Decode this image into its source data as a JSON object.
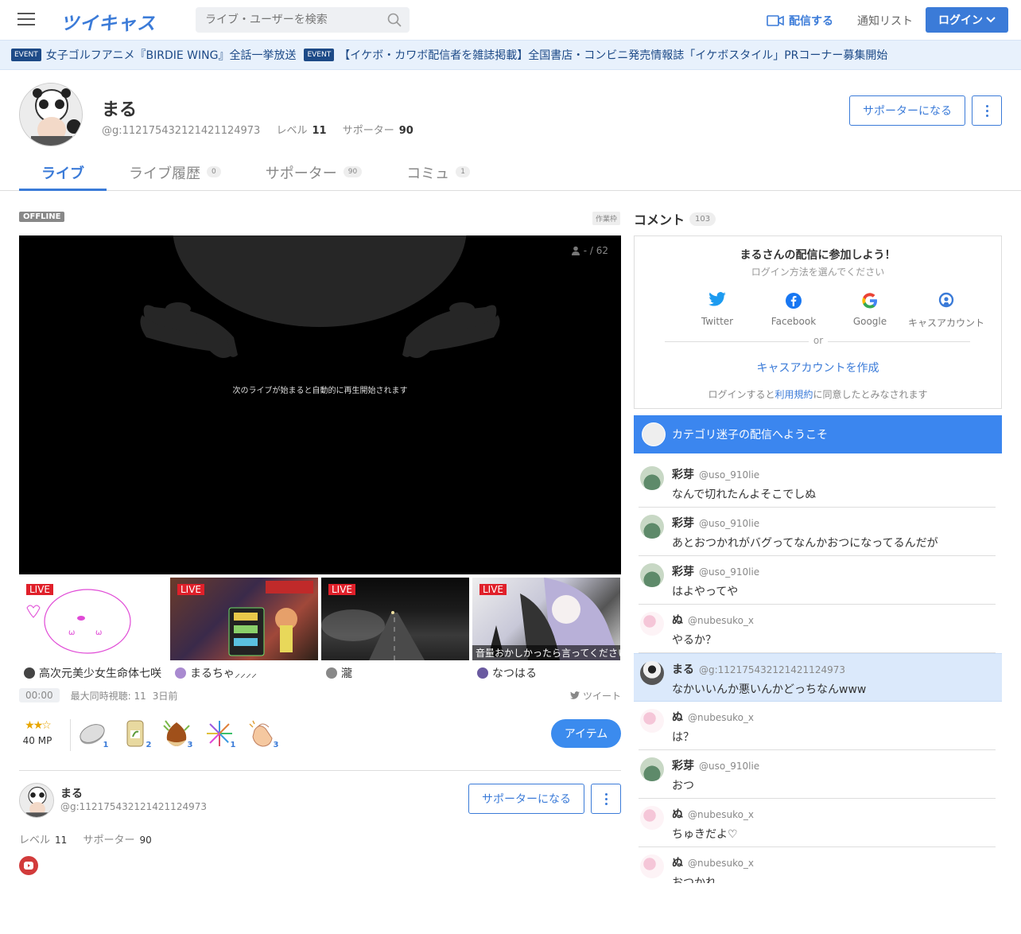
{
  "header": {
    "logo": "ツイキャス",
    "search_placeholder": "ライブ・ユーザーを検索",
    "stream_label": "配信する",
    "notif_label": "通知リスト",
    "login_label": "ログイン"
  },
  "events": [
    {
      "tag": "EVENT",
      "text": "女子ゴルフアニメ『BIRDIE WING』全話一挙放送"
    },
    {
      "tag": "EVENT",
      "text": "【イケボ・カワボ配信者を雑誌掲載】全国書店・コンビニ発売情報誌「イケボスタイル」PRコーナー募集開始"
    }
  ],
  "profile": {
    "name": "まる",
    "id": "@g:112175432121421124973",
    "level_label": "レベル",
    "level": "11",
    "supporter_label": "サポーター",
    "supporters": "90",
    "support_btn": "サポーターになる"
  },
  "tabs": [
    {
      "label": "ライブ",
      "count": ""
    },
    {
      "label": "ライブ履歴",
      "count": "0"
    },
    {
      "label": "サポーター",
      "count": "90"
    },
    {
      "label": "コミュ",
      "count": "1"
    }
  ],
  "player": {
    "status": "OFFLINE",
    "work_tag": "作業枠",
    "viewers": "- / 62",
    "message": "次のライブが始まると自動的に再生開始されます"
  },
  "thumbs": [
    {
      "live": "LIVE",
      "caption": "",
      "name": "高次元美少女生命体七咲"
    },
    {
      "live": "LIVE",
      "caption": "",
      "name": "まるちゃ⸝⸝⸝⸝"
    },
    {
      "live": "LIVE",
      "caption": "",
      "name": "  瀧  "
    },
    {
      "live": "LIVE",
      "caption": "音量おかしかったら言ってください",
      "name": "なつはる"
    }
  ],
  "timebar": {
    "time": "00:00",
    "max_viewers": "最大同時視聴: 11",
    "ago": "3日前",
    "tweet": "ツイート"
  },
  "items": {
    "mp": "40 MP",
    "gifts": [
      {
        "icon": "coin-icon",
        "count": "1"
      },
      {
        "icon": "tea-icon",
        "count": "2"
      },
      {
        "icon": "chestnut-icon",
        "count": "3"
      },
      {
        "icon": "firework-icon",
        "count": "1"
      },
      {
        "icon": "clap-icon",
        "count": "3"
      }
    ],
    "item_btn": "アイテム"
  },
  "small_profile": {
    "name": "まる",
    "id": "@g:112175432121421124973",
    "support_btn": "サポーターになる",
    "level_label": "レベル",
    "level": "11",
    "supporter_label": "サポーター",
    "supporters": "90"
  },
  "comments_panel": {
    "title": "コメント",
    "count": "103",
    "join_title": "まるさんの配信に参加しよう！",
    "join_sub": "ログイン方法を選んでください",
    "sns": [
      "Twitter",
      "Facebook",
      "Google",
      "キャスアカウント"
    ],
    "or": "or",
    "create": "キャスアカウントを作成",
    "terms_pre": "ログインすると",
    "terms_link": "利用規約",
    "terms_post": "に同意したとみなされます",
    "welcome": "カテゴリ迷子の配信へようこそ"
  },
  "comments": [
    {
      "name": "彩芽",
      "id": "@uso_910lie",
      "text": "なんで切れたんよそこでしぬ",
      "av": "sakura"
    },
    {
      "name": "彩芽",
      "id": "@uso_910lie",
      "text": "あとおつかれがバグってなんかおつになってるんだが",
      "av": "sakura"
    },
    {
      "name": "彩芽",
      "id": "@uso_910lie",
      "text": "はよやってや",
      "av": "sakura"
    },
    {
      "name": "ぬ",
      "id": "@nubesuko_x",
      "text": "やるか？",
      "av": "nu"
    },
    {
      "name": "まる",
      "id": "@g:112175432121421124973",
      "text": "なかいいんか悪いんかどっちなんwww",
      "av": "maru"
    },
    {
      "name": "ぬ",
      "id": "@nubesuko_x",
      "text": "は？",
      "av": "nu"
    },
    {
      "name": "彩芽",
      "id": "@uso_910lie",
      "text": "おつ",
      "av": "sakura"
    },
    {
      "name": "ぬ",
      "id": "@nubesuko_x",
      "text": "ちゅきだよ♡",
      "av": "nu"
    },
    {
      "name": "ぬ",
      "id": "@nubesuko_x",
      "text": "おつかれ",
      "av": "nu"
    }
  ]
}
